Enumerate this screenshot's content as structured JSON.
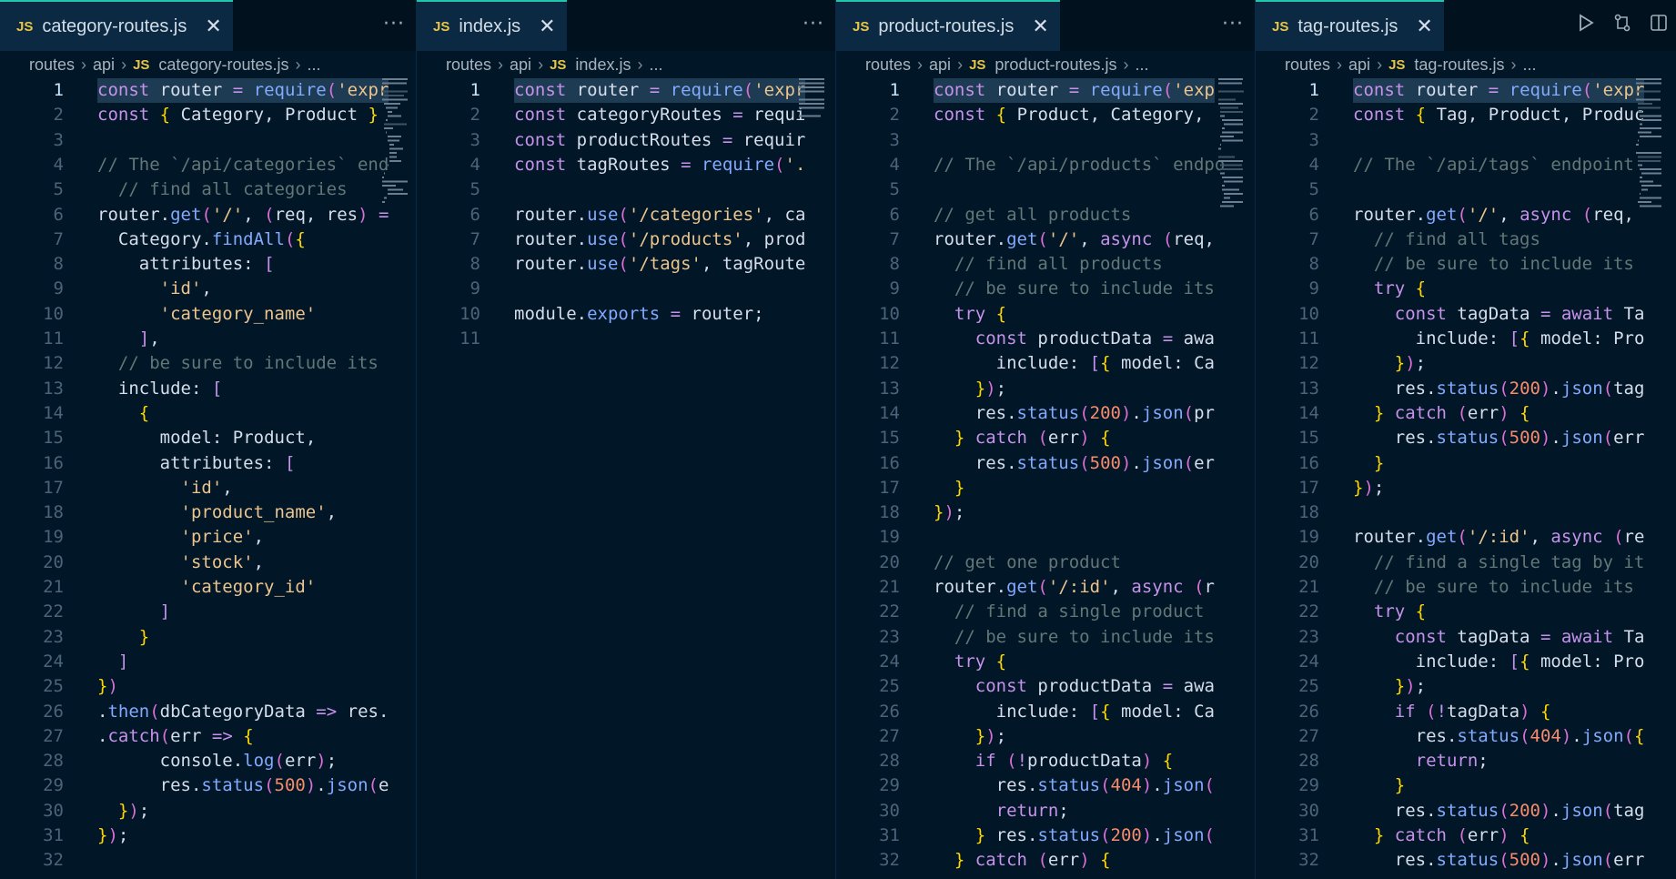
{
  "theme": {
    "bg": "#011627",
    "keyword": "#c792ea",
    "function": "#82aaff",
    "string": "#ecc48d",
    "comment": "#637777",
    "number": "#f78c6c",
    "punct": "#d6deeb",
    "accent": "#21c7a8",
    "badge": "#e8c547"
  },
  "panes": [
    {
      "tab": {
        "badge": "JS",
        "label": "category-routes.js",
        "close": "✕",
        "more": "···"
      },
      "breadcrumb": [
        "routes",
        "api",
        "category-routes.js",
        "..."
      ],
      "lines": [
        "const router = require('expr",
        "const { Category, Product }",
        "",
        "// The `/api/categories` end",
        "  // find all categories",
        "router.get('/', (req, res) =",
        "  Category.findAll({",
        "    attributes: [",
        "      'id',",
        "      'category_name'",
        "    ],",
        "  // be sure to include its",
        "  include: [",
        "    {",
        "      model: Product,",
        "      attributes: [",
        "        'id',",
        "        'product_name',",
        "        'price',",
        "        'stock',",
        "        'category_id'",
        "      ]",
        "    }",
        "  ]",
        "})",
        ".then(dbCategoryData => res.",
        ".catch(err => {",
        "      console.log(err);",
        "      res.status(500).json(e",
        "  });",
        "});",
        ""
      ]
    },
    {
      "tab": {
        "badge": "JS",
        "label": "index.js",
        "close": "✕",
        "more": "···"
      },
      "breadcrumb": [
        "routes",
        "api",
        "index.js",
        "..."
      ],
      "lines": [
        "const router = require('expr",
        "const categoryRoutes = requi",
        "const productRoutes = requir",
        "const tagRoutes = require('.",
        "",
        "router.use('/categories', ca",
        "router.use('/products', prod",
        "router.use('/tags', tagRoute",
        "",
        "module.exports = router;",
        ""
      ]
    },
    {
      "tab": {
        "badge": "JS",
        "label": "product-routes.js",
        "close": "✕",
        "more": "···"
      },
      "breadcrumb": [
        "routes",
        "api",
        "product-routes.js",
        "..."
      ],
      "lines": [
        "const router = require('exp",
        "const { Product, Category, ",
        "",
        "// The `/api/products` endpo",
        "",
        "// get all products",
        "router.get('/', async (req, ",
        "  // find all products",
        "  // be sure to include its",
        "  try {",
        "    const productData = awa",
        "      include: [{ model: Ca",
        "    });",
        "    res.status(200).json(pr",
        "  } catch (err) {",
        "    res.status(500).json(er",
        "  }",
        "});",
        "",
        "// get one product",
        "router.get('/:id', async (r",
        "  // find a single product ",
        "  // be sure to include its",
        "  try {",
        "    const productData = awa",
        "      include: [{ model: Ca",
        "    });",
        "    if (!productData) {",
        "      res.status(404).json(",
        "      return;",
        "    } res.status(200).json(",
        "  } catch (err) {"
      ]
    },
    {
      "tab": {
        "badge": "JS",
        "label": "tag-routes.js",
        "close": "✕"
      },
      "breadcrumb": [
        "routes",
        "api",
        "tag-routes.js",
        "..."
      ],
      "lines": [
        "const router = require('expr",
        "const { Tag, Product, Produc",
        "",
        "// The `/api/tags` endpoint",
        "",
        "router.get('/', async (req, ",
        "  // find all tags",
        "  // be sure to include its",
        "  try {",
        "    const tagData = await Ta",
        "      include: [{ model: Pro",
        "    });",
        "    res.status(200).json(tag",
        "  } catch (err) {",
        "    res.status(500).json(err",
        "  }",
        "});",
        "",
        "router.get('/:id', async (re",
        "  // find a single tag by it",
        "  // be sure to include its",
        "  try {",
        "    const tagData = await Ta",
        "      include: [{ model: Pro",
        "    });",
        "    if (!tagData) {",
        "      res.status(404).json({",
        "      return;",
        "    }",
        "    res.status(200).json(tag",
        "  } catch (err) {",
        "    res.status(500).json(err"
      ]
    }
  ],
  "toolbar": {
    "run": "run-icon",
    "compare": "compare-icon",
    "split": "split-editor-icon",
    "more": "···"
  }
}
